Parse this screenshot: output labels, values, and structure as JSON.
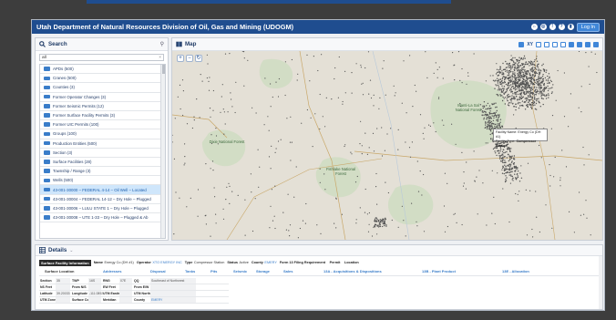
{
  "app": {
    "title": "Utah Department of Natural Resources Division of Oil, Gas and Mining (UDOGM)",
    "login_label": "Log In",
    "accent": "#1f4d8f"
  },
  "search": {
    "title": "Search",
    "filter_value": "all",
    "items": [
      {
        "label": "APDs (500)",
        "selected": false
      },
      {
        "label": "Cranes (500)",
        "selected": false
      },
      {
        "label": "Counties (3)",
        "selected": false
      },
      {
        "label": "Former Operator Changes (3)",
        "selected": false
      },
      {
        "label": "Former Seismic Permits (12)",
        "selected": false
      },
      {
        "label": "Former Surface Facility Permits (3)",
        "selected": false
      },
      {
        "label": "Former UIC Permits (100)",
        "selected": false
      },
      {
        "label": "Groups (100)",
        "selected": false
      },
      {
        "label": "Production Entities (500)",
        "selected": false
      },
      {
        "label": "Section (3)",
        "selected": false
      },
      {
        "label": "Surface Facilities (28)",
        "selected": false
      },
      {
        "label": "Township / Range (3)",
        "selected": false
      },
      {
        "label": "Wells (500)",
        "selected": false
      },
      {
        "label": "43-001-30000 – FEDERAL 4-14 – Oil Well – Located",
        "selected": true
      },
      {
        "label": "43-001-30004 – FEDERAL 14-12 – Dry Hole – Plugged",
        "selected": false
      },
      {
        "label": "43-001-30006 – LULU STATE 1 – Dry Hole – Plugged",
        "selected": false
      },
      {
        "label": "43-001-30008 – UTE 1-33 – Dry Hole – Plugged & Ab",
        "selected": false
      }
    ]
  },
  "map": {
    "title": "Map",
    "xy_label": "XY",
    "popup_name": "Facility Name: Energy Co (DH #1)",
    "popup_type_label": "Facility Type:",
    "popup_type_value": "Compressor Station",
    "labels": {
      "forest1": "Manti-La Sal National Forest",
      "forest2": "Dixie National Forest",
      "forest3": "Fishlake National Forest"
    }
  },
  "details": {
    "title": "Details",
    "tag": "Surface Facility Information",
    "fields": [
      {
        "k": "Name",
        "v": "Energy Co (DH #1)",
        "link": false
      },
      {
        "k": "Operator",
        "v": "XTO ENERGY INC",
        "link": true
      },
      {
        "k": "Type",
        "v": "Compressor Station",
        "link": false
      },
      {
        "k": "Status",
        "v": "Active",
        "link": false
      },
      {
        "k": "County",
        "v": "EMERY",
        "link": true
      },
      {
        "k": "Form 13 Filing Requirement",
        "v": "",
        "link": false
      },
      {
        "k": "Permit",
        "v": "",
        "link": false
      },
      {
        "k": "Location",
        "v": "",
        "link": false
      }
    ],
    "column_tabs": [
      "Surface Location",
      "Addresses",
      "Disposal",
      "Tanks",
      "Pits",
      "Seismic",
      "Storage",
      "Sales",
      "13A - Acquisitions & Dispositions",
      "13B - Plant Product",
      "13E - Allocation"
    ],
    "rows": [
      {
        "l1": "Section",
        "v1": "35",
        "l2": "TWP",
        "v2": "16S",
        "l3": "RNG",
        "v3": "07E",
        "l4": "QQ",
        "v4": "Southeast of Northwest",
        "v4link": false
      },
      {
        "l1": "NS Feet",
        "v1": "",
        "l2": "From N/S",
        "v2": "",
        "l3": "EW Feet",
        "v3": "",
        "l4": "From E/W",
        "v4": "",
        "v4link": false
      },
      {
        "l1": "Latitude",
        "v1": "39.20033",
        "l2": "Longitude",
        "v2": "-111.0892",
        "l3": "UTM Easting",
        "v3": "",
        "l4": "UTM Northing",
        "v4": "",
        "v4link": false
      },
      {
        "l1": "UTM Zone",
        "v1": "",
        "l2": "Surface Country",
        "v2": "",
        "l3": "Meridian",
        "v3": "",
        "l4": "County",
        "v4": "EMERY",
        "v4link": true
      }
    ]
  }
}
